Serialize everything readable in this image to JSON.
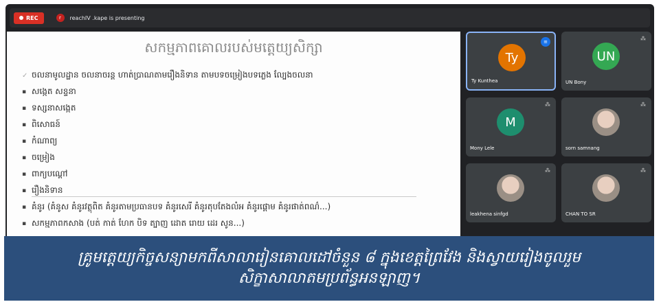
{
  "topbar": {
    "rec_label": "REC",
    "presenter_initial": "r",
    "presenting_text": "reachIV .kape is presenting"
  },
  "slide": {
    "title": "សកម្មភាពគោលរបស់មត្តេយ្យសិក្សា",
    "bullets": [
      {
        "marker": "✓",
        "text": "ចលនាមូលដ្ឋាន ចលនាចរន្ត ហាត់ប្រាណតាមរឿងនិទាន តាមបទចម្រៀងបទភ្លេង ល្បែងចលនា"
      },
      {
        "marker": "▪",
        "text": "សង្កេត សន្ទនា"
      },
      {
        "marker": "▪",
        "text": "ទស្សនាសង្កេត"
      },
      {
        "marker": "▪",
        "text": "ពិសោធន៍"
      },
      {
        "marker": "▪",
        "text": "កំណាព្យ"
      },
      {
        "marker": "▪",
        "text": "ចម្រៀង"
      },
      {
        "marker": "▪",
        "text": "ពាក្យបណ្តៅ"
      },
      {
        "marker": "▪",
        "text": "រឿងនិទាន"
      },
      {
        "marker": "▪",
        "text": "គំនូរ (គំនូស គំនូរវត្ថុពិត គំនូរតាមប្រធានបទ គំនូរសេរី គំនូរតុបតែងលំអ គំនូរផ្តោម គំនូរផាត់ពណ៌...)"
      },
      {
        "marker": "▪",
        "text": "សកម្មភាពកសាង (បត់ កាត់ ហែក បិទ ត្បាញ ដោត រោយ ដេរ សូន...)"
      }
    ]
  },
  "participants": [
    {
      "name": "Ty Kunthea",
      "initials": "Ty",
      "color": "#e37400",
      "type": "initials",
      "speaking": true
    },
    {
      "name": "UN Bony",
      "initials": "UN",
      "color": "#34a853",
      "type": "initials",
      "speaking": false
    },
    {
      "name": "Mony Lele",
      "initials": "M",
      "color": "#1e8e6e",
      "type": "initials",
      "speaking": false
    },
    {
      "name": "sorn samnang",
      "initials": "",
      "color": "#9a8f85",
      "type": "photo",
      "speaking": false
    },
    {
      "name": "leakhena sinfgd",
      "initials": "",
      "color": "#6a8a5a",
      "type": "photo",
      "speaking": false
    },
    {
      "name": "CHAN TO SR",
      "initials": "",
      "color": "#7a6a60",
      "type": "photo",
      "speaking": false
    }
  ],
  "icons": {
    "mic_off": "mic-off-icon",
    "speaking": "speaking-indicator-icon"
  },
  "caption": {
    "line1": "គ្រូមត្តេយ្យកិច្ចសន្យាមកពីសាលារៀនគោលដៅចំនួន ៨ ក្នុងខេត្តព្រៃវែង និងស្វាយរៀងចូលរួម",
    "line2": "សិក្ខាសាលាតមប្រព័ន្ធអនឡាញ។"
  },
  "colors": {
    "caption_bg": "#2c4f7c",
    "rec": "#d93025",
    "active_border": "#8ab4f8"
  }
}
